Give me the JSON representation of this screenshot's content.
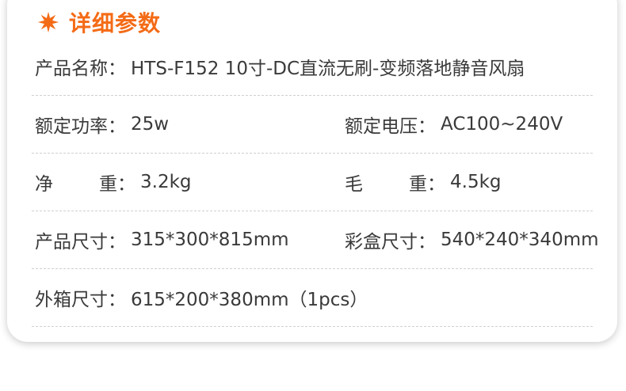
{
  "section": {
    "title": "详细参数",
    "icon": "burst-star-icon",
    "accent": "#f46b16"
  },
  "specs": {
    "name": {
      "label": "产品名称",
      "value": "HTS-F152 10寸-DC直流无刷-变频落地静音风扇"
    },
    "power": {
      "label": "额定功率",
      "value": "25w"
    },
    "voltage": {
      "label": "额定电压",
      "value": "AC100~240V"
    },
    "net_weight": {
      "label_a": "净",
      "label_b": "重",
      "value": "3.2kg"
    },
    "gross_weight": {
      "label_a": "毛",
      "label_b": "重",
      "value": "4.5kg"
    },
    "product_size": {
      "label": "产品尺寸",
      "value": "315*300*815mm"
    },
    "box_size": {
      "label": "彩盒尺寸",
      "value": "540*240*340mm"
    },
    "carton_size": {
      "label": "外箱尺寸",
      "value": "615*200*380mm（1pcs）"
    },
    "colon": "："
  }
}
